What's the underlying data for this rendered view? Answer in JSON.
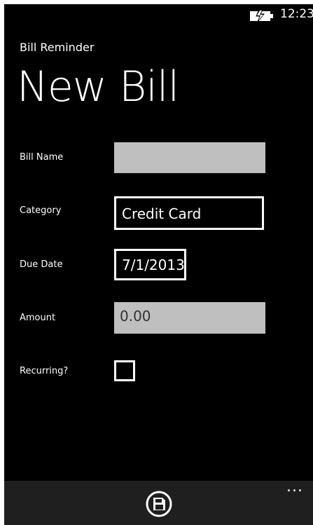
{
  "status_bar": {
    "time": "12:23",
    "battery_icon": "battery-charging-icon"
  },
  "header": {
    "app_name": "Bill Reminder",
    "page_title": "New Bill"
  },
  "form": {
    "bill_name": {
      "label": "Bill Name",
      "value": ""
    },
    "category": {
      "label": "Category",
      "value": "Credit Card"
    },
    "due_date": {
      "label": "Due Date",
      "value": "7/1/2013"
    },
    "amount": {
      "label": "Amount",
      "value": "0.00"
    },
    "recurring": {
      "label": "Recurring?",
      "checked": false
    }
  },
  "app_bar": {
    "save_icon": "save-icon",
    "more_label": "..."
  },
  "colors": {
    "background": "#000000",
    "foreground": "#ffffff",
    "textbox_fill": "#bfbfbf",
    "app_bar": "#1f1f1f"
  }
}
